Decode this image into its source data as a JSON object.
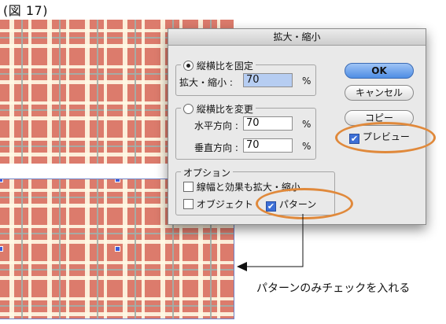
{
  "figure_label": "(図 17)",
  "dialog": {
    "title": "拡大・縮小",
    "uniform_group": {
      "label": "縦横比を固定",
      "selected": true
    },
    "scale": {
      "label": "拡大・縮小 :",
      "value": "70",
      "unit": "%"
    },
    "nonuniform_group": {
      "label": "縦横比を変更",
      "selected": false
    },
    "horizontal": {
      "label": "水平方向 :",
      "value": "70",
      "unit": "%"
    },
    "vertical": {
      "label": "垂直方向 :",
      "value": "70",
      "unit": "%"
    },
    "options": {
      "title": "オプション",
      "scale_strokes": {
        "label": "線幅と効果も拡大・縮小",
        "checked": false
      },
      "objects": {
        "label": "オブジェクト",
        "checked": false
      },
      "patterns": {
        "label": "パターン",
        "checked": true
      }
    },
    "buttons": {
      "ok": "OK",
      "cancel": "キャンセル",
      "copy": "コピー"
    },
    "preview": {
      "label": "プレビュー",
      "checked": true
    }
  },
  "annotation": {
    "text": "パターンのみチェックを入れる",
    "highlight_color": "#e0893b"
  },
  "plaid_colors": {
    "base": "#dc7b6c",
    "light": "#fff8e4",
    "thin": "#a0afaa",
    "selection": "#3d5ad6"
  }
}
